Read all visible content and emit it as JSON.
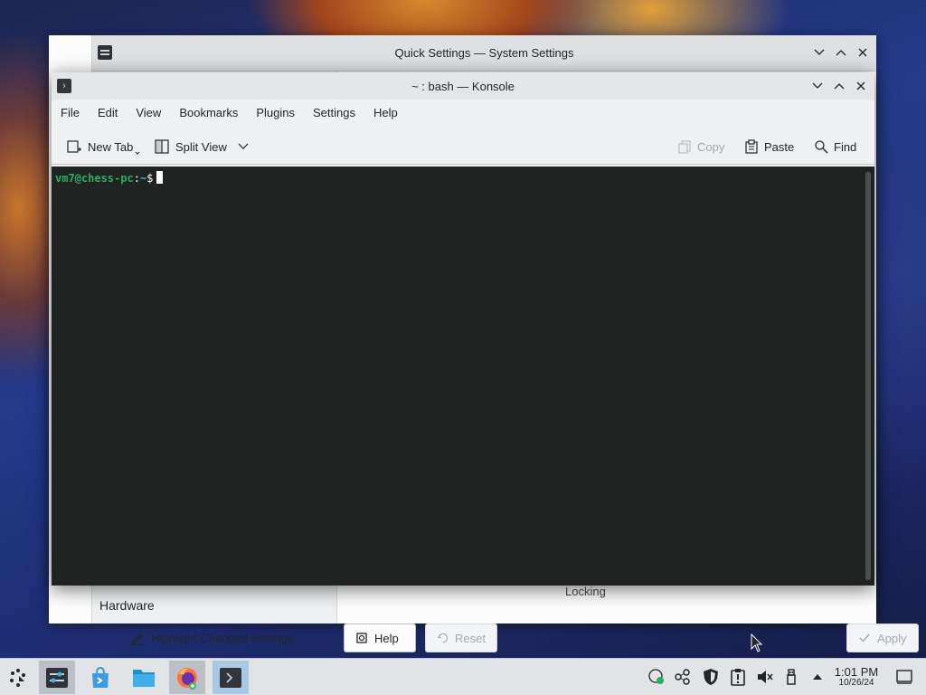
{
  "system_settings": {
    "title": "Quick Settings — System Settings",
    "sidebar_item": "Hardware",
    "content_label": "Locking",
    "buttons": {
      "highlight": "Highlight Changed Settings",
      "help": "Help",
      "reset": "Reset",
      "apply": "Apply"
    }
  },
  "konsole": {
    "title": "~ : bash — Konsole",
    "menu": [
      "File",
      "Edit",
      "View",
      "Bookmarks",
      "Plugins",
      "Settings",
      "Help"
    ],
    "toolbar": {
      "new_tab": "New Tab",
      "split_view": "Split View",
      "copy": "Copy",
      "paste": "Paste",
      "find": "Find"
    },
    "prompt": {
      "user_host": "vm7@chess-pc",
      "sep": ":",
      "path": "~",
      "symbol": "$"
    }
  },
  "taskbar": {
    "apps": [
      "application-launcher",
      "system-settings",
      "discover",
      "dolphin",
      "firefox",
      "konsole"
    ],
    "clock": {
      "time": "1:01 PM",
      "date": "10/26/24"
    }
  },
  "colors": {
    "terminal_bg": "#1f2423",
    "prompt_user": "#27ae60",
    "prompt_path": "#3daee9",
    "accent": "#3daee9"
  }
}
